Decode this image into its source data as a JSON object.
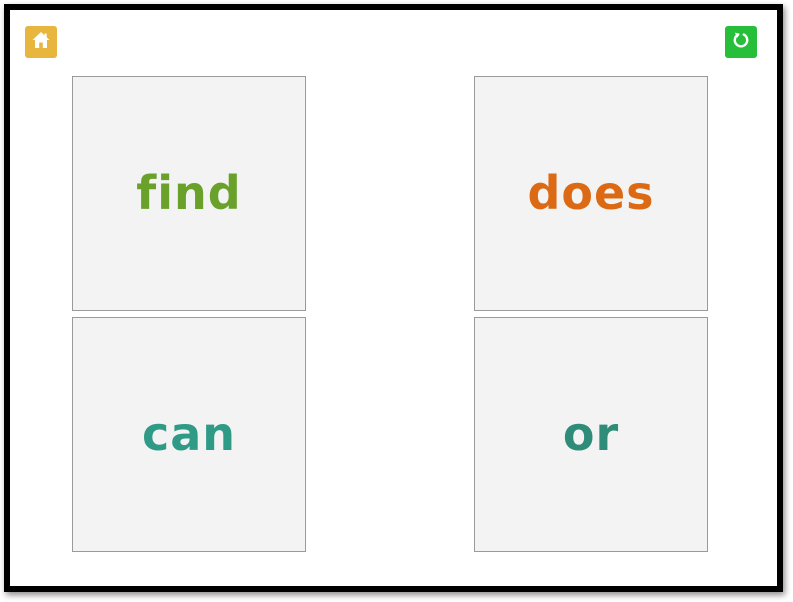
{
  "toolbar": {
    "home_icon": "home-icon",
    "reset_icon": "refresh-icon",
    "home_color": "#e8b53e",
    "reset_color": "#27be3a"
  },
  "cards": [
    {
      "word": "find",
      "color": "#6aa12a"
    },
    {
      "word": "does",
      "color": "#dc6a14"
    },
    {
      "word": "can",
      "color": "#2f9b86"
    },
    {
      "word": "or",
      "color": "#2f8c78"
    }
  ]
}
